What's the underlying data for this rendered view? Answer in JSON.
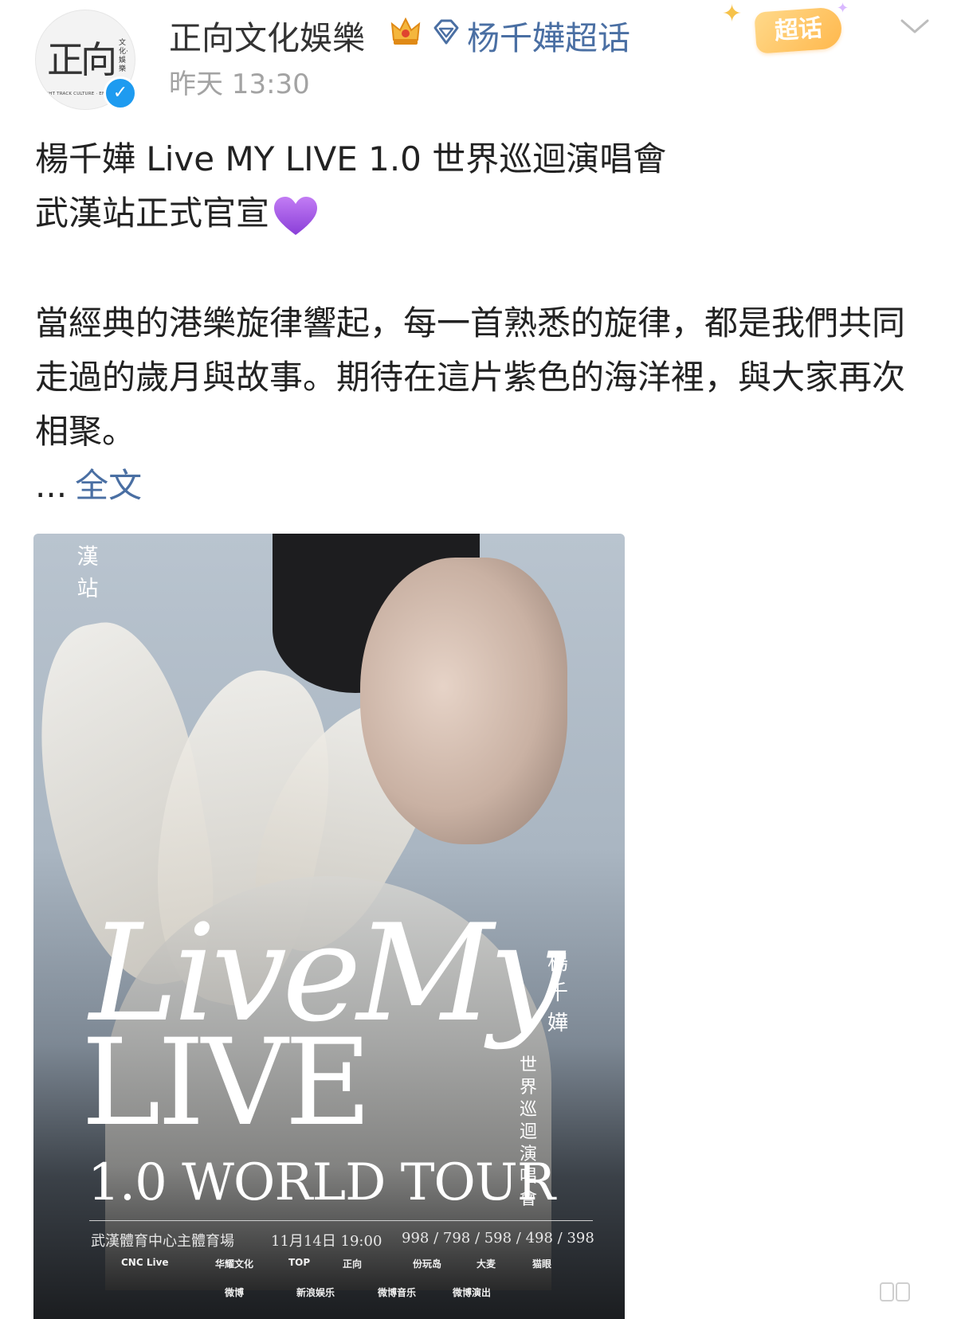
{
  "header": {
    "author_name": "正向文化娛樂",
    "topic_name": "杨千嬅超话",
    "badge_label": "超话",
    "time": "昨天 13:30",
    "avatar": {
      "main_text": "正向",
      "side_text": "文化·娛樂",
      "sub_text": "RIGHT TRACK CULTURE · ENTER"
    },
    "icons": [
      "crown-icon",
      "diamond-icon",
      "chevron-down-icon",
      "verified-icon"
    ]
  },
  "post": {
    "title_line1": "楊千嬅 Live MY LIVE 1.0 世界巡迴演唱會",
    "title_line2": "武漢站正式官宣",
    "body": "當經典的港樂旋律響起，每一首熟悉的旋律，都是我們共同走過的歲月與故事。期待在這片紫色的海洋裡，與大家再次相聚。",
    "ellipsis": "...",
    "full_text_label": "全文"
  },
  "poster": {
    "station": "漢站",
    "live_line1": "LiveMy",
    "live_line2": "LIVE",
    "singer_name": "楊千嬅",
    "concert_sub": "世界巡迴演唱會",
    "tour": "1.0 WORLD TOUR",
    "venue": "武漢體育中心主體育場",
    "date": "11月14日 19:00",
    "prices": "998 / 798 / 598 / 498 / 398",
    "logos": [
      "CNC Live",
      "华耀文化",
      "TOP",
      "正向",
      "份玩岛",
      "大麦",
      "猫眼",
      "微博",
      "新浪娱乐",
      "微博音乐",
      "微博演出"
    ]
  },
  "colors": {
    "link": "#4a6fa3",
    "time_gray": "#a3a3a3",
    "verified_blue": "#1e9bf0",
    "badge_gold": "#ffb84d",
    "heart_purple": "#a35ee6"
  }
}
